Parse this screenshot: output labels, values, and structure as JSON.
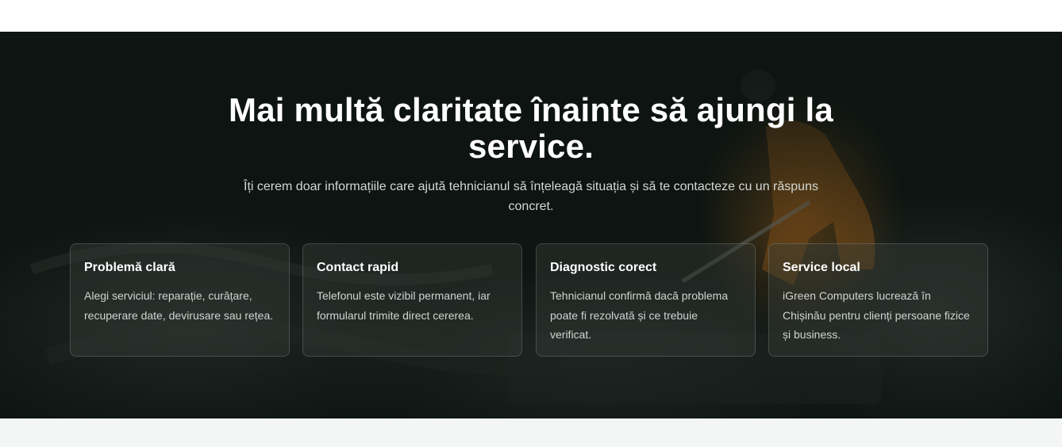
{
  "hero": {
    "title": "Mai multă claritate înainte să ajungi la service.",
    "subtitle": "Îți cerem doar informațiile care ajută tehnicianul să înțeleagă situația și să te contacteze cu un răspuns concret."
  },
  "cards": [
    {
      "title": "Problemă clară",
      "text": "Alegi serviciul: reparație, curățare, recuperare date, devirusare sau rețea."
    },
    {
      "title": "Contact rapid",
      "text": "Telefonul este vizibil permanent, iar formularul trimite direct cererea."
    },
    {
      "title": "Diagnostic corect",
      "text": "Tehnicianul confirmă dacă problema poate fi rezolvată și ce trebuie verificat."
    },
    {
      "title": "Service local",
      "text": "iGreen Computers lucrează în Chișinău pentru clienți persoane fizice și business."
    }
  ],
  "colors": {
    "hero_background": "#0d1411",
    "figure_accent": "#d98a22",
    "card_background": "#2f3632",
    "bottom_strip": "#f3f6f4"
  }
}
